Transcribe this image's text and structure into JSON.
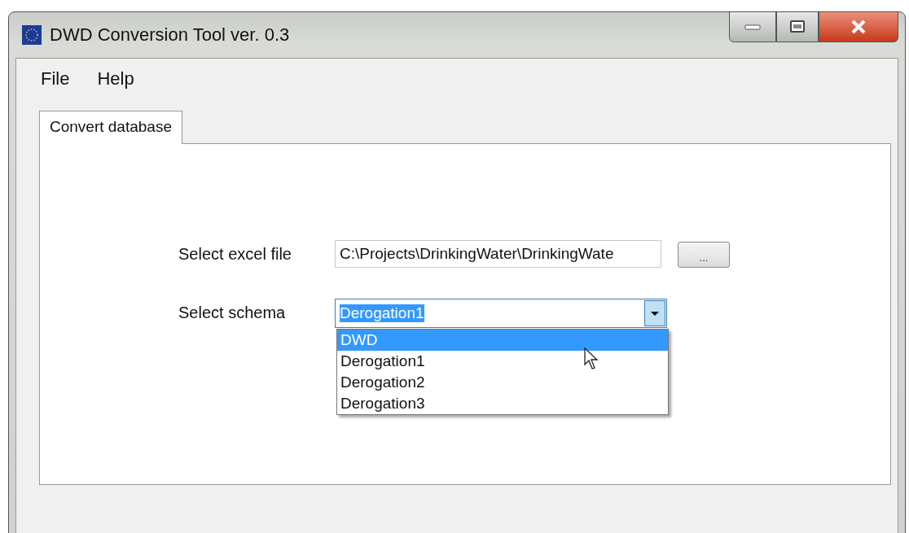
{
  "window": {
    "title": "DWD Conversion Tool ver. 0.3"
  },
  "menu": [
    "File",
    "Help"
  ],
  "tabs": [
    {
      "label": "Convert database",
      "selected": true
    }
  ],
  "form": {
    "file_label": "Select excel file",
    "file_value": "C:\\Projects\\DrinkingWater\\DrinkingWate",
    "browse_button": "...",
    "schema_label": "Select schema",
    "schema_value": "Derogation1",
    "schema_options": [
      {
        "label": "DWD",
        "selected": true
      },
      {
        "label": "Derogation1",
        "selected": false
      },
      {
        "label": "Derogation2",
        "selected": false
      },
      {
        "label": "Derogation3",
        "selected": false
      }
    ]
  }
}
